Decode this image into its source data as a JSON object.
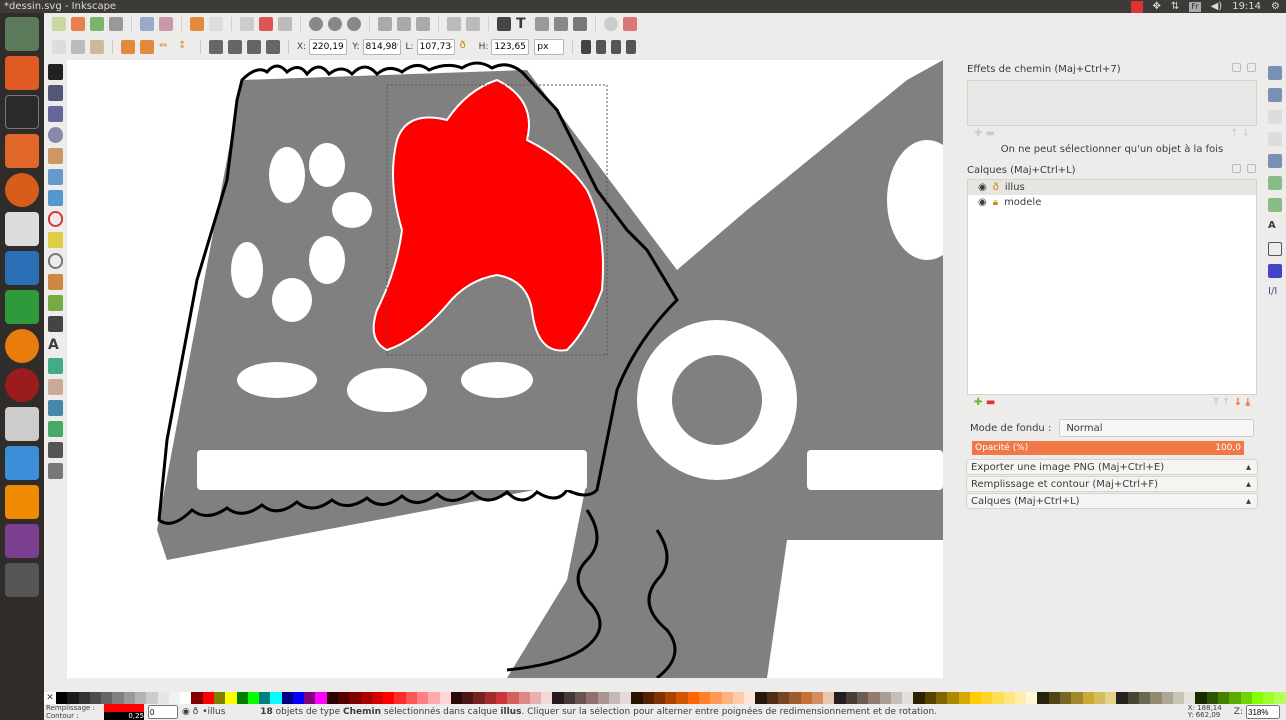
{
  "window": {
    "title": "*dessin.svg - Inkscape"
  },
  "tray": {
    "lang": "Fr",
    "time": "19:14"
  },
  "toolbar": {
    "x_label": "X:",
    "x": "220,192",
    "y_label": "Y:",
    "y": "814,989",
    "w_label": "L:",
    "w": "107,734",
    "h_label": "H:",
    "h": "123,659",
    "unit": "px"
  },
  "panels": {
    "path_effects": {
      "title": "Effets de chemin (Maj+Ctrl+7)",
      "message": "On ne peut sélectionner qu'un objet à la fois"
    },
    "layers": {
      "title": "Calques (Maj+Ctrl+L)",
      "items": [
        {
          "name": "illus"
        },
        {
          "name": "modele"
        }
      ],
      "blend_label": "Mode de fondu :",
      "blend_value": "Normal",
      "opacity_label": "Opacité (%)",
      "opacity_value": "100,0"
    },
    "collapsed": [
      {
        "label": "Exporter une image PNG (Maj+Ctrl+E)"
      },
      {
        "label": "Remplissage et contour (Maj+Ctrl+F)"
      },
      {
        "label": "Calques (Maj+Ctrl+L)"
      }
    ]
  },
  "status": {
    "fill_label": "Remplissage :",
    "stroke_label": "Contour :",
    "stroke_width": "0,25",
    "opacity": "0",
    "layer": "•illus",
    "count": "18",
    "msg1": " objets de type ",
    "type": "Chemin",
    "msg2": " sélectionnés dans calque ",
    "layer_name": "illus",
    "msg3": ". Cliquer sur la sélection pour alterner entre poignées de redimensionnement et de rotation.",
    "cursor_x": "X: 188,14",
    "cursor_y": "Y: 662,09",
    "zoom_label": "Z:",
    "zoom": "318%"
  },
  "colors": {
    "accent": "#f07746",
    "fill": "#ff0000",
    "shape": "#808080"
  },
  "palette": [
    "#000000",
    "#1a1a1a",
    "#333333",
    "#4d4d4d",
    "#666666",
    "#808080",
    "#999999",
    "#b3b3b3",
    "#cccccc",
    "#e6e6e6",
    "#f2f2f2",
    "#ffffff",
    "#800000",
    "#ff0000",
    "#808000",
    "#ffff00",
    "#008000",
    "#00ff00",
    "#008080",
    "#00ffff",
    "#000080",
    "#0000ff",
    "#800080",
    "#ff00ff",
    "#2b0000",
    "#550000",
    "#800000",
    "#aa0000",
    "#d40000",
    "#ff0000",
    "#ff2a2a",
    "#ff5555",
    "#ff8080",
    "#ffaaaa",
    "#ffd5d5",
    "#280b0b",
    "#501616",
    "#782121",
    "#a02c2c",
    "#c83737",
    "#d35f5f",
    "#de8787",
    "#e9afaf",
    "#f4d7d7",
    "#241c1c",
    "#483737",
    "#6c5353",
    "#916f6f",
    "#ac9393",
    "#c8b7b7",
    "#e3dbdb",
    "#2b1100",
    "#552200",
    "#803300",
    "#aa4400",
    "#d45500",
    "#ff6600",
    "#ff7f2a",
    "#ff9955",
    "#ffb380",
    "#ffccaa",
    "#ffe6d5",
    "#28170b",
    "#502d16",
    "#784421",
    "#a05a2c",
    "#c87137",
    "#d38d5f",
    "#e9c6af",
    "#241f1c",
    "#483e37",
    "#6c5d53",
    "#917c6f",
    "#ac9d93",
    "#c8beb7",
    "#e3dedb",
    "#2b2200",
    "#554400",
    "#806600",
    "#aa8800",
    "#d4aa00",
    "#ffcc00",
    "#ffd42a",
    "#ffdd55",
    "#ffe680",
    "#ffeeaa",
    "#fff6d5",
    "#28220b",
    "#504416",
    "#786721",
    "#a0892c",
    "#c8ab37",
    "#d4bd5f",
    "#e3d287",
    "#24221c",
    "#484537",
    "#6c6753",
    "#918a6f",
    "#aca793",
    "#c8c4b7",
    "#e3e2db",
    "#162b00",
    "#2d5500",
    "#448000",
    "#5aaa00",
    "#71d400",
    "#88ff00",
    "#9cff2a",
    "#b3ff55"
  ]
}
